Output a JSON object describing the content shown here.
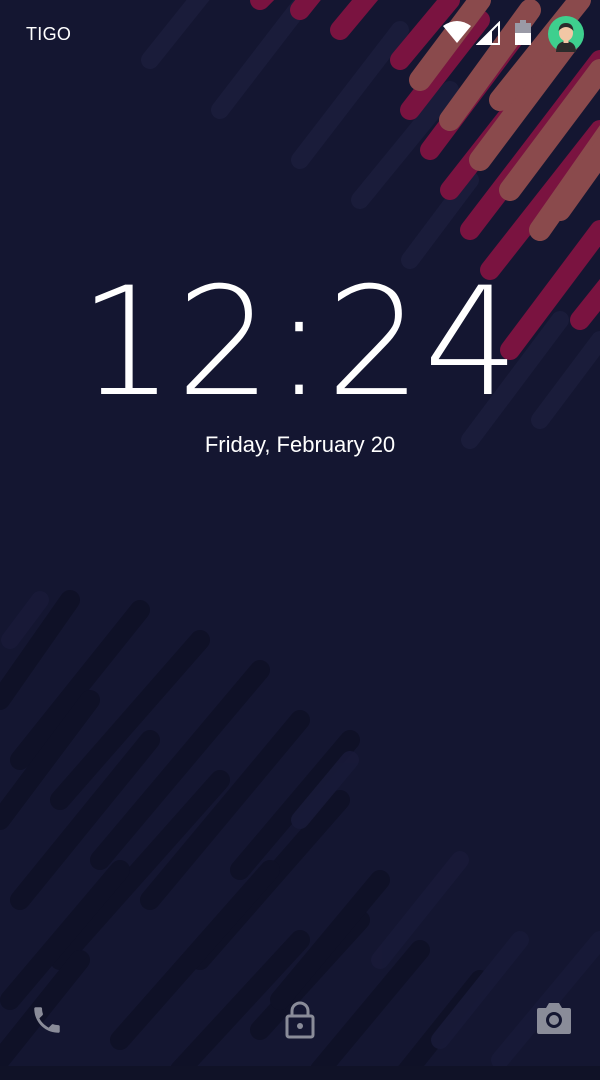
{
  "status_bar": {
    "carrier": "TIGO",
    "icons": [
      "wifi-icon",
      "cell-signal-icon",
      "battery-icon",
      "user-avatar-icon"
    ]
  },
  "lockscreen": {
    "time": "12:24",
    "date": "Friday, February 20"
  },
  "shortcuts": {
    "left": "phone-icon",
    "center": "unlock-icon",
    "right": "camera-icon"
  },
  "colors": {
    "background": "#141631",
    "stripe_red": "#7a1340",
    "stripe_salmon": "#8a4a4c",
    "stripe_dark": "#0e1024",
    "icon_gray": "#8a8c99",
    "avatar_green": "#3ecf8e"
  }
}
